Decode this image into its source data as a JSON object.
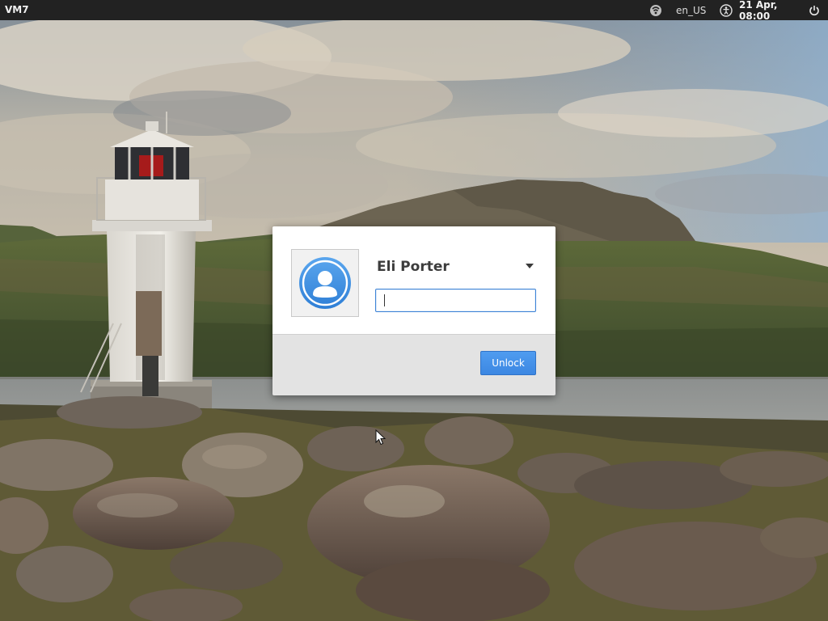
{
  "top_panel": {
    "host_name": "VM7",
    "keyboard_layout": "en_US",
    "clock": "21 Apr, 08:00",
    "icons": {
      "network": "network-icon",
      "accessibility": "accessibility-icon",
      "power": "power-icon"
    }
  },
  "login_dialog": {
    "user_name": "Eli Porter",
    "password_value": "",
    "unlock_label": "Unlock",
    "avatar_icon": "user-avatar-icon",
    "accent_color": "#3c87e2"
  },
  "wallpaper": {
    "scene": "lighthouse-coast"
  }
}
